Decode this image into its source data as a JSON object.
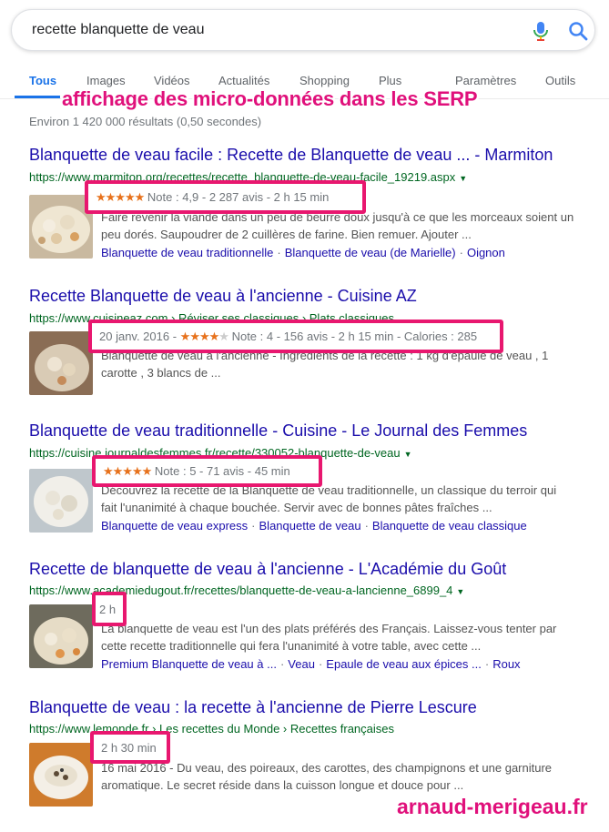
{
  "search": {
    "query": "recette blanquette de veau"
  },
  "tabs": {
    "all": "Tous",
    "images": "Images",
    "videos": "Vidéos",
    "news": "Actualités",
    "shopping": "Shopping",
    "more": "Plus",
    "settings": "Paramètres",
    "tools": "Outils"
  },
  "overlay": {
    "title": "affichage des micro-données dans les SERP",
    "watermark": "arnaud-merigeau.fr"
  },
  "stats": "Environ 1 420 000 résultats (0,50 secondes)",
  "colors": {
    "link": "#1a0dab",
    "url": "#006621",
    "highlight": "#e8176f",
    "star": "#e7711b",
    "accent": "#1a73e8"
  },
  "results": [
    {
      "title": "Blanquette de veau facile : Recette de Blanquette de veau ... - Marmiton",
      "url": "https://www.marmiton.org/recettes/recette_blanquette-de-veau-facile_19219.aspx",
      "stars": "★★★★★",
      "rich": "Note : 4,9 - 2 287 avis - 2 h 15 min",
      "snippet": "Faire revenir la viande dans un peu de beurre doux jusqu'à ce que les morceaux soient un peu dorés. Saupoudrer de 2 cuillères de farine. Bien remuer. Ajouter ...",
      "links": [
        "Blanquette de veau traditionnelle",
        "Blanquette de veau (de Marielle)",
        "Oignon"
      ]
    },
    {
      "title": "Recette Blanquette de veau à l'ancienne - Cuisine AZ",
      "url": "https://www.cuisineaz.com › Réviser ses classiques › Plats classiques",
      "date": "20 janv. 2016 -",
      "stars_on": "★★★★",
      "stars_off": "★",
      "rich": "Note : 4 - 156 avis - 2 h 15 min - Calories : 285",
      "snippet": "Blanquette de veau à l'ancienne - Ingrédients de la recette : 1 kg d'épaule de veau , 1 carotte , 3 blancs de ..."
    },
    {
      "title": "Blanquette de veau traditionnelle - Cuisine - Le Journal des Femmes",
      "url": "https://cuisine.journaldesfemmes.fr/recette/330052-blanquette-de-veau",
      "stars": "★★★★★",
      "rich": "Note : 5 - 71 avis - 45 min",
      "snippet": "Découvrez la recette de la Blanquette de veau traditionnelle, un classique du terroir qui fait l'unanimité à chaque bouchée. Servir avec de bonnes pâtes fraîches ...",
      "links": [
        "Blanquette de veau express",
        "Blanquette de veau",
        "Blanquette de veau classique"
      ]
    },
    {
      "title": "Recette de blanquette de veau à l'ancienne - L'Académie du Goût",
      "url": "https://www.academiedugout.fr/recettes/blanquette-de-veau-a-lancienne_6899_4",
      "rich": "2 h",
      "snippet": "La blanquette de veau est l'un des plats préférés des Français. Laissez-vous tenter par cette recette traditionnelle qui fera l'unanimité à votre table, avec cette ...",
      "links": [
        "Premium Blanquette de veau à ...",
        "Veau",
        "Epaule de veau aux épices ...",
        "Roux"
      ]
    },
    {
      "title": "Blanquette de veau : la recette à l'ancienne de Pierre Lescure",
      "url": "https://www.lemonde.fr › Les recettes du Monde › Recettes françaises",
      "rich": "2 h 30 min",
      "snippet": "16 mai 2016 - Du veau, des poireaux, des carottes, des champignons et une garniture aromatique. Le secret réside dans la cuisson longue et douce pour ..."
    }
  ]
}
